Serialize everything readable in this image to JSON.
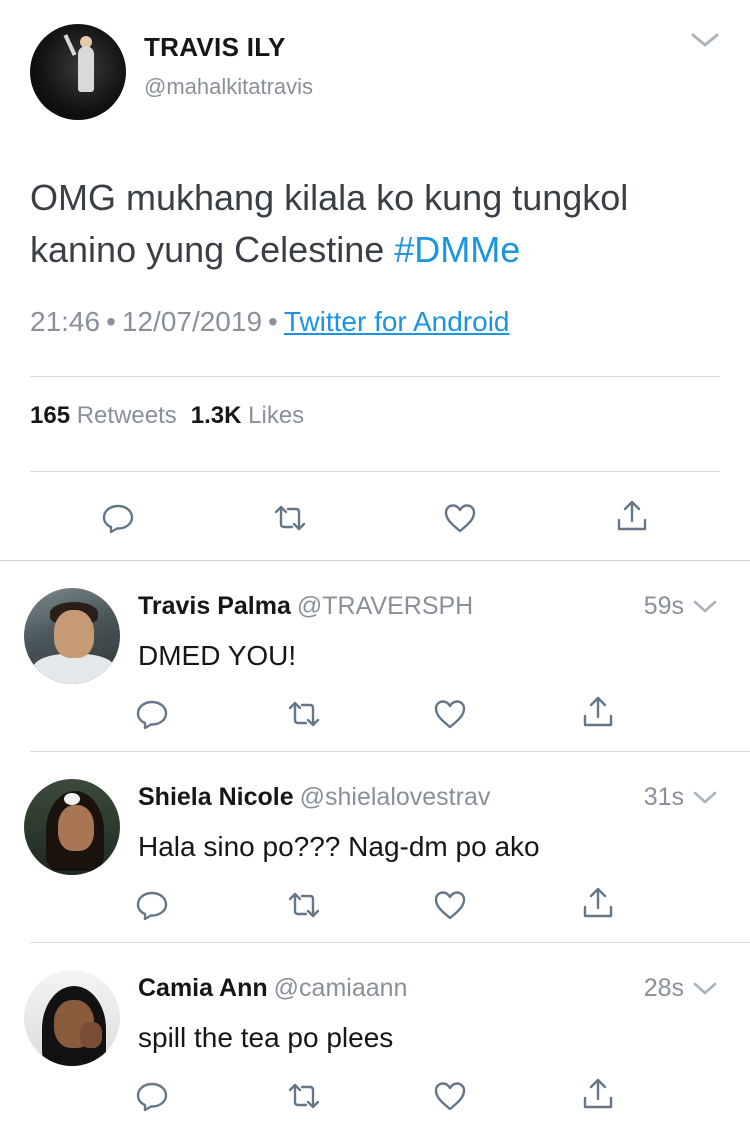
{
  "main_tweet": {
    "author_name": "TRAVIS ILY",
    "author_handle": "@mahalkitatravis",
    "text": "OMG mukhang kilala ko kung tungkol kanino yung Celestine ",
    "hashtag": "#DMMe",
    "time": "21:46",
    "date": "12/07/2019",
    "source": "Twitter for Android",
    "retweet_count": "165",
    "retweet_label": "Retweets",
    "like_count": "1.3K",
    "like_label": "Likes"
  },
  "replies": [
    {
      "name": "Travis Palma",
      "handle": "@TRAVERSPH",
      "time": "59s",
      "text": "DMED YOU!"
    },
    {
      "name": "Shiela Nicole",
      "handle": "@shielalovestrav",
      "time": "31s",
      "text": "Hala sino po??? Nag-dm po ako"
    },
    {
      "name": "Camia Ann",
      "handle": "@camiaann",
      "time": "28s",
      "text": "spill the tea po plees"
    }
  ],
  "separator": "•",
  "colors": {
    "link": "#1b95e0",
    "secondary_text": "#8a9099",
    "icon": "#657786"
  },
  "icons": [
    "reply-icon",
    "retweet-icon",
    "like-icon",
    "share-icon",
    "chevron-down-icon"
  ]
}
